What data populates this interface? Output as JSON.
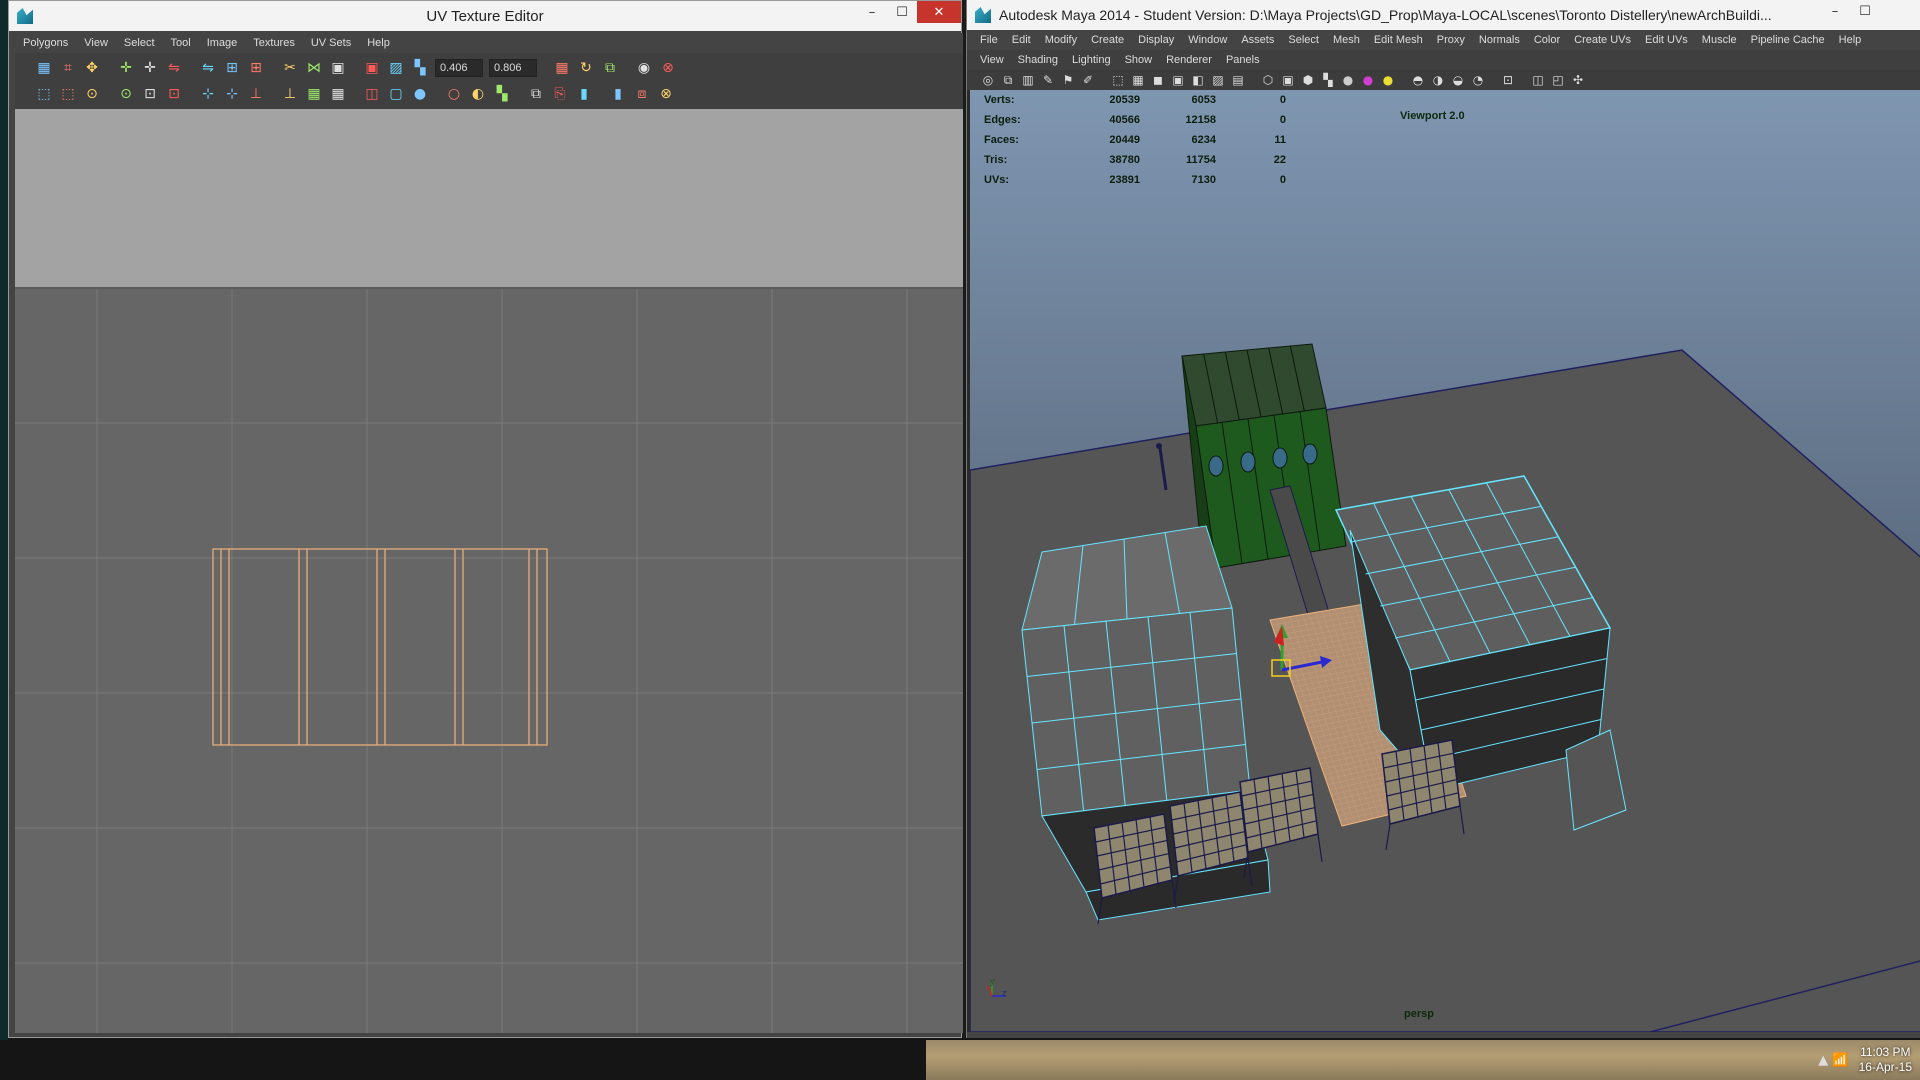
{
  "uv_editor": {
    "title": "UV Texture Editor",
    "menus": [
      "Polygons",
      "View",
      "Select",
      "Tool",
      "Image",
      "Textures",
      "UV Sets",
      "Help"
    ],
    "u_field": "0.406",
    "v_field": "0.806",
    "toolbar_icons": {
      "row1": [
        "grid-select-icon",
        "lattice-icon",
        "move-uv-icon",
        "translate-icon",
        "translate-icon",
        "flip-icon",
        "flip-icon",
        "align-icon",
        "align-icon",
        "cut-icon",
        "sew-icon",
        "layout-icon",
        "layout-icon",
        "image-icon",
        "checker-icon",
        "grid-icon",
        "rotate-icon",
        "copy-icon",
        "shader-icon",
        "pin-icon"
      ],
      "row2": [
        "select-icon",
        "select-icon",
        "rotate-cw-icon",
        "rotate-ccw-icon",
        "snap-icon",
        "snap-icon",
        "unfold-icon",
        "unfold-icon",
        "straighten-icon",
        "straighten-icon",
        "grid-icon",
        "grid-icon",
        "dim-icon",
        "texture-border-icon",
        "rgb-icon",
        "alpha-icon",
        "shaded-icon",
        "checker-icon",
        "copy-icon",
        "paste-icon",
        "delete-icon",
        "delete-icon",
        "uv-snapshot-icon",
        "close-icon"
      ]
    }
  },
  "maya": {
    "title": "Autodesk Maya 2014 - Student Version: D:\\Maya Projects\\GD_Prop\\Maya-LOCAL\\scenes\\Toronto Distellery\\newArchBuildi...",
    "menus": [
      "File",
      "Edit",
      "Modify",
      "Create",
      "Display",
      "Window",
      "Assets",
      "Select",
      "Mesh",
      "Edit Mesh",
      "Proxy",
      "Normals",
      "Color",
      "Create UVs",
      "Edit UVs",
      "Muscle",
      "Pipeline Cache",
      "Help"
    ],
    "panel_menus": [
      "View",
      "Shading",
      "Lighting",
      "Show",
      "Renderer",
      "Panels"
    ],
    "hud": [
      {
        "label": "Verts:",
        "a": "20539",
        "b": "6053",
        "c": "0"
      },
      {
        "label": "Edges:",
        "a": "40566",
        "b": "12158",
        "c": "0"
      },
      {
        "label": "Faces:",
        "a": "20449",
        "b": "6234",
        "c": "11"
      },
      {
        "label": "Tris:",
        "a": "38780",
        "b": "11754",
        "c": "22"
      },
      {
        "label": "UVs:",
        "a": "23891",
        "b": "7130",
        "c": "0"
      }
    ],
    "renderer_label": "Viewport 2.0",
    "camera_label": "persp",
    "axis_labels": {
      "y": "y",
      "z": "z"
    }
  },
  "taskbar": {
    "time": "11:03 PM",
    "date": "16-Apr-15",
    "tray_glyphs": "▲ 📶"
  },
  "colors": {
    "uv_lines": "#f0b27a",
    "selection_wire": "#66e6ff",
    "green_building": "#1e5a1e",
    "viewport_sky": "#7f96b1",
    "ground": "#555555"
  }
}
